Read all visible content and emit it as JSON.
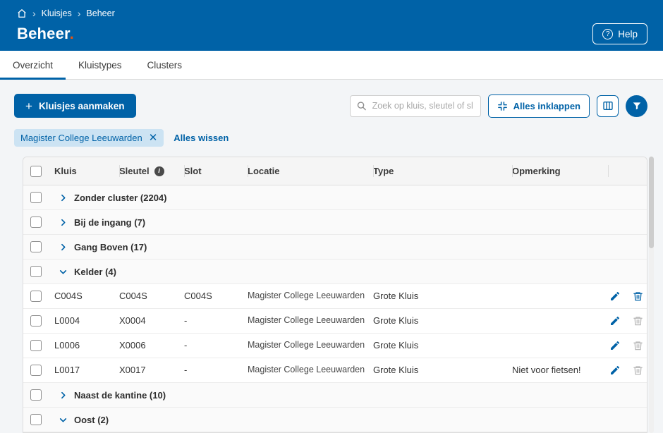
{
  "colors": {
    "primary": "#0062a7",
    "accent_dot": "#e8530f",
    "chip_bg": "#cce3f3"
  },
  "header": {
    "breadcrumb": {
      "items": [
        "Kluisjes",
        "Beheer"
      ]
    },
    "title": "Beheer",
    "title_dot": ".",
    "help_label": "Help"
  },
  "tabs": [
    {
      "label": "Overzicht",
      "active": true
    },
    {
      "label": "Kluistypes",
      "active": false
    },
    {
      "label": "Clusters",
      "active": false
    }
  ],
  "toolbar": {
    "create_button": "Kluisjes aanmaken",
    "search_placeholder": "Zoek op kluis, sleutel of slot",
    "collapse_all": "Alles inklappen"
  },
  "filters": {
    "chip": "Magister College Leeuwarden",
    "clear_all": "Alles wissen"
  },
  "table": {
    "columns": [
      "Kluis",
      "Sleutel",
      "Slot",
      "Locatie",
      "Type",
      "Opmerking"
    ],
    "groups": [
      {
        "label": "Zonder cluster (2204)",
        "expanded": false,
        "rows": []
      },
      {
        "label": "Bij de ingang (7)",
        "expanded": false,
        "rows": []
      },
      {
        "label": "Gang Boven (17)",
        "expanded": false,
        "rows": []
      },
      {
        "label": "Kelder (4)",
        "expanded": true,
        "rows": [
          {
            "kluis": "C004S",
            "sleutel": "C004S",
            "slot": "C004S",
            "locatie": "Magister College Leeuwarden",
            "type": "Grote Kluis",
            "opmerking": "",
            "delete_enabled": true
          },
          {
            "kluis": "L0004",
            "sleutel": "X0004",
            "slot": "-",
            "locatie": "Magister College Leeuwarden",
            "type": "Grote Kluis",
            "opmerking": "",
            "delete_enabled": false
          },
          {
            "kluis": "L0006",
            "sleutel": "X0006",
            "slot": "-",
            "locatie": "Magister College Leeuwarden",
            "type": "Grote Kluis",
            "opmerking": "",
            "delete_enabled": false
          },
          {
            "kluis": "L0017",
            "sleutel": "X0017",
            "slot": "-",
            "locatie": "Magister College Leeuwarden",
            "type": "Grote Kluis",
            "opmerking": "Niet voor fietsen!",
            "delete_enabled": false
          }
        ]
      },
      {
        "label": "Naast de kantine (10)",
        "expanded": false,
        "rows": []
      },
      {
        "label": "Oost (2)",
        "expanded": true,
        "rows": []
      }
    ]
  }
}
